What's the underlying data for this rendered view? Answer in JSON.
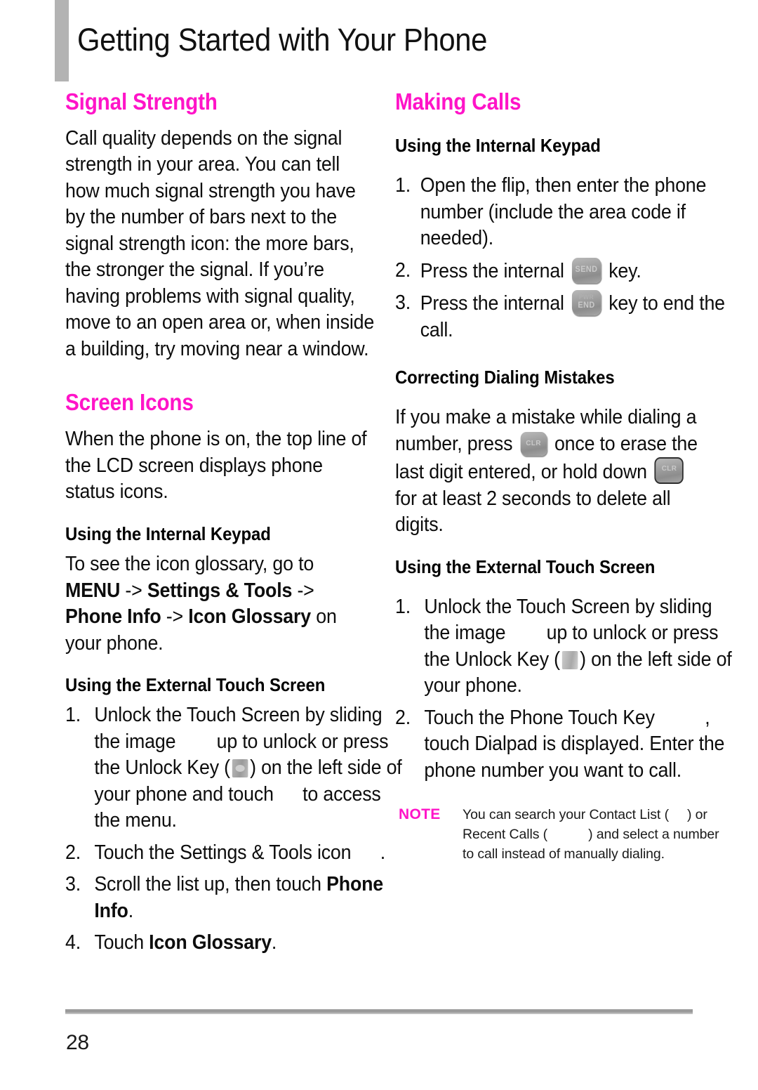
{
  "page": {
    "title": "Getting Started with Your Phone",
    "number": "28",
    "accent_color": "#ff14c8",
    "rule_color": "#9a9a9a"
  },
  "left_column": {
    "signal_strength": {
      "heading": "Signal Strength",
      "paragraph": "Call quality depends on the signal strength in your area. You can tell how much signal strength you have by the number of bars next to the signal strength icon: the more bars, the stronger the signal. If you’re having problems with signal quality, move to an open area or, when inside a building, try moving near a window."
    },
    "screen_icons": {
      "heading": "Screen Icons",
      "paragraph": "When the phone is on, the top line of the LCD screen displays phone status icons.",
      "internal_keypad": {
        "heading": "Using the Internal Keypad",
        "line1": "To see the icon glossary, go to",
        "menu_path_1": "MENU",
        "arrow_1": " -> ",
        "menu_path_2": "Settings & Tools",
        "arrow_2": " -> ",
        "menu_path_3": "Phone Info",
        "arrow_3": " -> ",
        "menu_path_4": "Icon Glossary",
        "tail": " on your phone."
      },
      "external_touch": {
        "heading": "Using the External Touch Screen",
        "steps": [
          {
            "num": "1.",
            "part_a": "Unlock the Touch Screen by sliding the image",
            "part_b": "up to unlock or press the Unlock Key (",
            "part_c": ") on the left side of your phone and touch",
            "part_d": "to access the menu."
          },
          {
            "num": "2.",
            "part_a": "Touch the Settings & Tools icon",
            "part_b": "."
          },
          {
            "num": "3.",
            "part_a": "Scroll the list up, then touch ",
            "bold": "Phone Info",
            "part_b": "."
          },
          {
            "num": "4.",
            "part_a": "Touch ",
            "bold": "Icon Glossary",
            "part_b": "."
          }
        ]
      }
    }
  },
  "right_column": {
    "making_calls": {
      "heading": "Making Calls",
      "internal_keypad": {
        "heading": "Using the Internal Keypad",
        "steps": [
          {
            "num": "1.",
            "text": "Open the flip, then enter the phone number (include the area code if needed)."
          },
          {
            "num": "2.",
            "part_a": "Press the internal",
            "part_b": "key."
          },
          {
            "num": "3.",
            "part_a": "Press the internal",
            "part_b": "key to end the call."
          }
        ]
      },
      "correcting": {
        "heading": "Correcting Dialing Mistakes",
        "part_a": "If you make a mistake while dialing a number, press",
        "part_b": "once to erase the last digit entered, or hold down",
        "part_c": "for at least 2 seconds to delete all digits."
      },
      "external_touch": {
        "heading": "Using the External Touch Screen",
        "steps": [
          {
            "num": "1.",
            "part_a": "Unlock the Touch Screen by sliding the image",
            "part_b": "up to unlock or press the Unlock Key (",
            "part_c": ") on the left side of your phone."
          },
          {
            "num": "2.",
            "part_a": "Touch the Phone Touch Key",
            "part_b": ", touch Dialpad is displayed. Enter the phone number you want to call."
          }
        ]
      },
      "note": {
        "label": "NOTE",
        "part_a": "You can search your Contact List (",
        "part_b": ") or Recent Calls (",
        "part_c": ") and select a number to call instead of manually dialing."
      }
    }
  },
  "key_icons": {
    "send": "SEND",
    "end_top": "PWR",
    "end_bottom": "END",
    "clr": "CLR"
  }
}
